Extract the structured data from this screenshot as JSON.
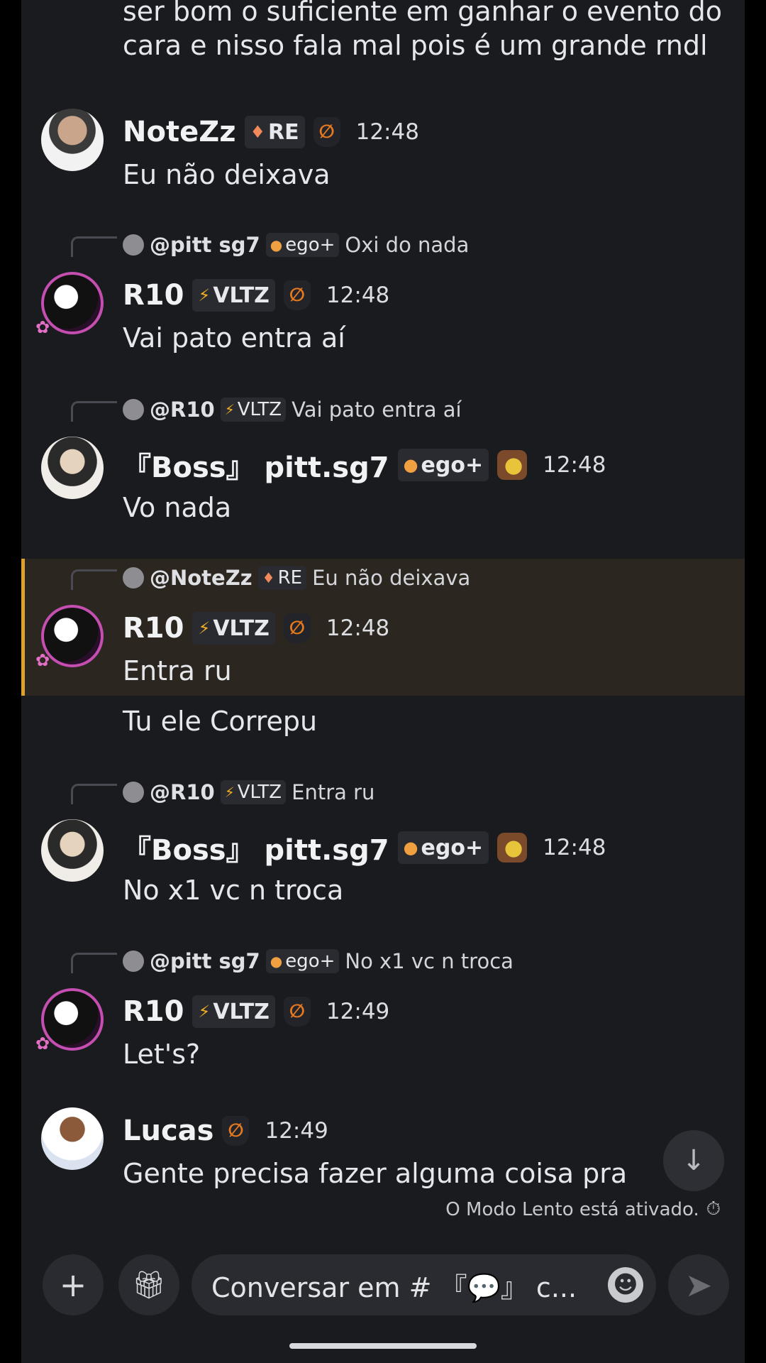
{
  "messages": {
    "prev_text_line1": "ser bom o suficiente em ganhar o evento do",
    "prev_text_line2": "cara e nisso fala mal pois é um grande rndl",
    "m1": {
      "user": "NoteZz",
      "tag": "RE",
      "time": "12:48",
      "text": "Eu não deixava"
    },
    "m2": {
      "reply": {
        "name": "@pitt sg7",
        "tag": "ego+",
        "text": "Oxi do nada"
      },
      "user": "R10",
      "tag": "VLTZ",
      "time": "12:48",
      "text": "Vai pato entra aí"
    },
    "m3": {
      "reply": {
        "name": "@R10",
        "tag": "VLTZ",
        "text": "Vai pato entra aí"
      },
      "user": "『Boss』 pitt.sg7",
      "tag": "ego+",
      "time": "12:48",
      "text": "Vo nada"
    },
    "m4": {
      "reply": {
        "name": "@NoteZz",
        "tag": "RE",
        "text": "Eu não deixava"
      },
      "user": "R10",
      "tag": "VLTZ",
      "time": "12:48",
      "text": "Entra ru",
      "text2": "Tu ele Correpu"
    },
    "m5": {
      "reply": {
        "name": "@R10",
        "tag": "VLTZ",
        "text": "Entra ru"
      },
      "user": "『Boss』 pitt.sg7",
      "tag": "ego+",
      "time": "12:48",
      "text": "No x1 vc n troca"
    },
    "m6": {
      "reply": {
        "name": "@pitt sg7",
        "tag": "ego+",
        "text": "No x1 vc n troca"
      },
      "user": "R10",
      "tag": "VLTZ",
      "time": "12:49",
      "text": "Let's?"
    },
    "m7": {
      "user": "Lucas",
      "time": "12:49",
      "text": "Gente precisa fazer alguma coisa pra"
    }
  },
  "slowmode": "O Modo Lento está ativado.",
  "input": {
    "placeholder": "Conversar em # 『💬』 c..."
  },
  "colors": {
    "background": "#1a1b1f",
    "highlight_bar": "#e0a12c",
    "highlight_bg": "#2b2620"
  }
}
